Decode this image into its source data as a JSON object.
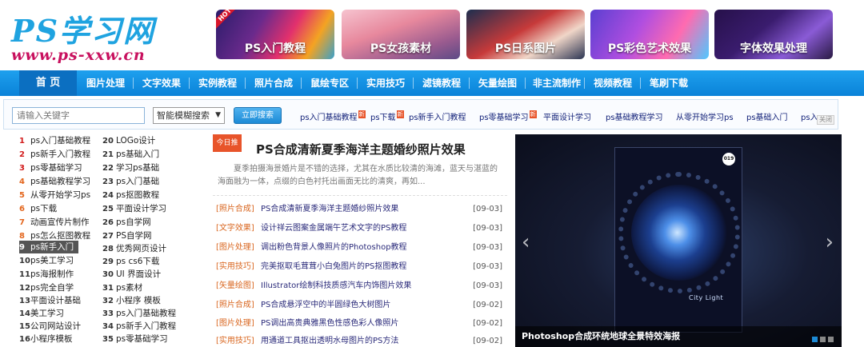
{
  "logo": {
    "main": "PS学习网",
    "url": "www.ps-xxw.cn"
  },
  "banners": [
    {
      "label": "PS入门教程",
      "hot": "HOT"
    },
    {
      "label": "PS女孩素材"
    },
    {
      "label": "PS日系图片"
    },
    {
      "label": "PS彩色艺术效果"
    },
    {
      "label": "字体效果处理"
    }
  ],
  "nav": {
    "home": "首 页",
    "items": [
      "图片处理",
      "文字效果",
      "实例教程",
      "照片合成",
      "鼠绘专区",
      "实用技巧",
      "滤镜教程",
      "矢量绘图",
      "非主流制作",
      "视频教程",
      "笔刷下载"
    ]
  },
  "search": {
    "placeholder": "请输入关键字",
    "mode": "智能模糊搜索",
    "button": "立即搜索",
    "new_badge": "新",
    "links": [
      "ps入门基础教程",
      "ps下载",
      "ps新手入门教程",
      "ps零基础学习",
      "平面设计学习",
      "ps基础教程学习",
      "从零开始学习ps",
      "ps基础入门",
      "ps入"
    ],
    "close": "关闭"
  },
  "rank": {
    "col1": [
      {
        "n": "1",
        "t": "ps入门基础教程"
      },
      {
        "n": "2",
        "t": "ps新手入门教程"
      },
      {
        "n": "3",
        "t": "ps零基础学习"
      },
      {
        "n": "4",
        "t": "ps基础教程学习"
      },
      {
        "n": "5",
        "t": "从零开始学习ps"
      },
      {
        "n": "6",
        "t": "ps下载"
      },
      {
        "n": "7",
        "t": "动画宣传片制作"
      },
      {
        "n": "8",
        "t": "ps怎么抠图教程"
      },
      {
        "n": "9",
        "t": "ps新手入门"
      },
      {
        "n": "10",
        "t": "ps美工学习"
      },
      {
        "n": "11",
        "t": "ps海报制作"
      },
      {
        "n": "12",
        "t": "ps完全自学"
      },
      {
        "n": "13",
        "t": "平面设计基础"
      },
      {
        "n": "14",
        "t": "美工学习"
      },
      {
        "n": "15",
        "t": "公司网站设计"
      },
      {
        "n": "16",
        "t": "小程序模板"
      }
    ],
    "col2": [
      {
        "n": "20",
        "t": "LOGo设计"
      },
      {
        "n": "21",
        "t": "ps基础入门"
      },
      {
        "n": "22",
        "t": "学习ps基础"
      },
      {
        "n": "23",
        "t": "ps入门基础"
      },
      {
        "n": "24",
        "t": "ps抠图教程"
      },
      {
        "n": "25",
        "t": "平面设计学习"
      },
      {
        "n": "26",
        "t": "ps自学网"
      },
      {
        "n": "27",
        "t": "PS自学网"
      },
      {
        "n": "28",
        "t": "优秀网页设计"
      },
      {
        "n": "29",
        "t": "ps cs6下载"
      },
      {
        "n": "30",
        "t": "UI 界面设计"
      },
      {
        "n": "31",
        "t": "ps素材"
      },
      {
        "n": "32",
        "t": "小程序 模板"
      },
      {
        "n": "33",
        "t": "ps入门基础教程"
      },
      {
        "n": "34",
        "t": "ps新手入门教程"
      },
      {
        "n": "35",
        "t": "ps零基础学习"
      }
    ]
  },
  "featured": {
    "badge": "今日推",
    "title": "PS合成清新夏季海洋主题婚纱照片效果",
    "desc": "夏季拍摄海景婚片是不错的选择，尤其在水质比较清的海滩，蓝天与湛蓝的海面融为一体，点缀的白色衬托出画面无比的清爽，再如..."
  },
  "articles": [
    {
      "cat": "[照片合成]",
      "title": "PS合成清新夏季海洋主题婚纱照片效果",
      "date": "[09-03]"
    },
    {
      "cat": "[文字效果]",
      "title": "设计祥云图案金属端午艺术文字的PS教程",
      "date": "[09-03]"
    },
    {
      "cat": "[图片处理]",
      "title": "调出粉色背景人像照片的Photoshop教程",
      "date": "[09-03]"
    },
    {
      "cat": "[实用技巧]",
      "title": "完美抠取毛茸茸小白兔图片的PS抠图教程",
      "date": "[09-03]"
    },
    {
      "cat": "[矢量绘图]",
      "title": "Illustrator绘制科技质感汽车内饰图片效果",
      "date": "[09-03]"
    },
    {
      "cat": "[照片合成]",
      "title": "PS合成悬浮空中的半圆绿色大树图片",
      "date": "[09-02]"
    },
    {
      "cat": "[图片处理]",
      "title": "PS调出高贵典雅黑色性感色彩人像照片",
      "date": "[09-02]"
    },
    {
      "cat": "[实用技巧]",
      "title": "用通道工具抠出透明水母图片的PS方法",
      "date": "[09-02]"
    }
  ],
  "slide": {
    "caption": "Photoshop合成环统地球全景特效海报",
    "poster_text": "City Light",
    "poster_num": "019",
    "prev": "‹",
    "next": "›"
  }
}
